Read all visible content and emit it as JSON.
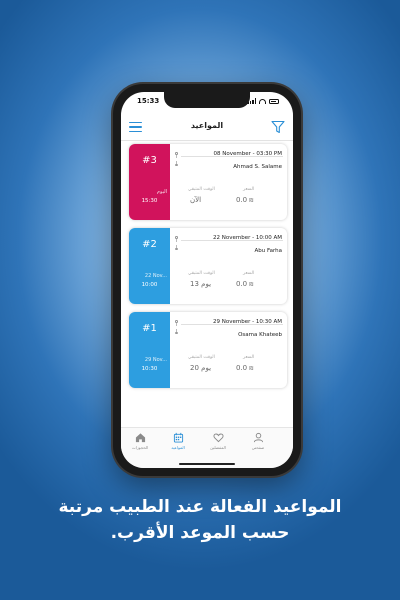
{
  "status_bar": {
    "time": "15:33"
  },
  "header": {
    "title": "المواعيد"
  },
  "labels": {
    "price": "السعر",
    "remaining": "الوقت المتبقي"
  },
  "appointments": [
    {
      "number": "#3",
      "color": "#d1135c",
      "datetime": "08 November - 03:30 PM",
      "doctor": "Ahmad S. Salame",
      "side_label": "اليوم",
      "side_value": "15:30",
      "price": "0.0",
      "currency": "₪",
      "remaining": "الآن"
    },
    {
      "number": "#2",
      "color": "#2d9ee0",
      "datetime": "22 November - 10:00 AM",
      "doctor": "Abu Farha",
      "side_label": "22 Nov...",
      "side_value": "10:00",
      "price": "0.0",
      "currency": "₪",
      "remaining": "13 يوم"
    },
    {
      "number": "#1",
      "color": "#2d9ee0",
      "datetime": "29 November - 10:30 AM",
      "doctor": "Osama Khateeb",
      "side_label": "29 Nov...",
      "side_value": "10:30",
      "price": "0.0",
      "currency": "₪",
      "remaining": "20 يوم"
    }
  ],
  "tabs": [
    {
      "label": "الحجوزات",
      "icon": "home-icon"
    },
    {
      "label": "المواعيد",
      "icon": "calendar-icon",
      "active": true
    },
    {
      "label": "المفضلين",
      "icon": "heart-icon"
    },
    {
      "label": "صفحتي",
      "icon": "user-icon"
    }
  ],
  "caption": {
    "line1": "المواعيد الفعالة عند الطبيب مرتبة",
    "line2": "حسب الموعد الأقرب."
  },
  "colors": {
    "accent": "#2b8fd6",
    "urgent": "#d1135c",
    "background": "#2f74b8"
  }
}
